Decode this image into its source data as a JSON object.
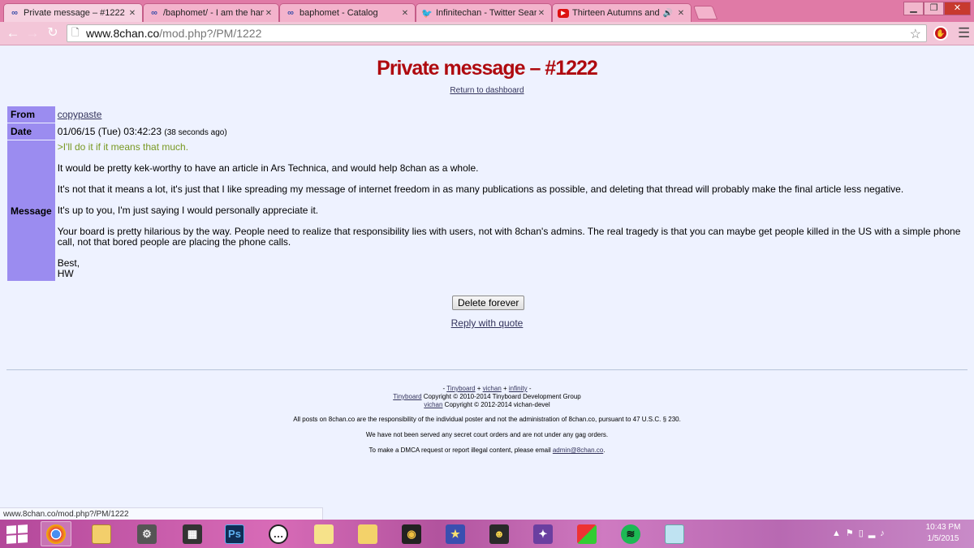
{
  "browser": {
    "tabs": [
      {
        "title": "Private message – #1222",
        "icon": "8chan-icon",
        "active": true
      },
      {
        "title": "/baphomet/ - I am the hammer",
        "icon": "8chan-icon",
        "active": false
      },
      {
        "title": "baphomet - Catalog",
        "icon": "8chan-icon",
        "active": false
      },
      {
        "title": "Infinitechan - Twitter Search",
        "icon": "twitter-icon",
        "active": false
      },
      {
        "title": "Thirteen Autumns and",
        "icon": "youtube-icon",
        "active": false
      }
    ],
    "url_host": "www.8chan.co",
    "url_path": "/mod.php?/PM/1222",
    "status_url": "www.8chan.co/mod.php?/PM/1222"
  },
  "page": {
    "title": "Private message – #1222",
    "return_link": "Return to dashboard",
    "from_label": "From",
    "from_value": "copypaste",
    "date_label": "Date",
    "date_value": "01/06/15 (Tue) 03:42:23",
    "date_ago": "(38 seconds ago)",
    "message_label": "Message",
    "message": {
      "quote": ">I'll do it if it means that much.",
      "p1": "It would be pretty kek-worthy to have an article in Ars Technica, and would help 8chan as a whole.",
      "p2": "It's not that it means a lot, it's just that I like spreading my message of internet freedom in as many publications as possible, and deleting that thread will probably make the final article less negative.",
      "p3": "It's up to you, I'm just saying I would personally appreciate it.",
      "p4": "Your board is pretty hilarious by the way. People need to realize that responsibility lies with users, not with 8chan's admins. The real tragedy is that you can maybe get people killed in the US with a simple phone call, not that bored people are placing the phone calls.",
      "sign1": "Best,",
      "sign2": "HW"
    },
    "delete_button": "Delete forever",
    "reply_link": "Reply with quote"
  },
  "footer": {
    "dash_left": "- ",
    "tinyboard": "Tinyboard",
    "plus1": " + ",
    "vichan": "vichan",
    "plus2": " + ",
    "infinity": "infinity",
    "dash_right": " -",
    "tinyboard_copy": " Copyright © 2010-2014 Tinyboard Development Group",
    "vichan_copy": " Copyright © 2012-2014 vichan-devel",
    "notice1": "All posts on 8chan.co are the responsibility of the individual poster and not the administration of 8chan.co, pursuant to 47 U.S.C. § 230.",
    "notice2": "We have not been served any secret court orders and are not under any gag orders.",
    "notice3_prefix": "To make a DMCA request or report illegal content, please email ",
    "notice3_email": "admin@8chan.co",
    "notice3_suffix": "."
  },
  "taskbar": {
    "time": "10:43 PM",
    "date": "1/5/2015",
    "apps": [
      "chrome-icon",
      "file-explorer-icon",
      "settings-app-icon",
      "media-app-icon",
      "photoshop-icon",
      "chat-app-icon",
      "anime-app-icon-1",
      "anime-app-icon-2",
      "anime-app-icon-3",
      "anime-app-icon-4",
      "anime-app-icon-5",
      "anime-app-icon-6",
      "games-app-icon",
      "spotify-icon",
      "notes-app-icon"
    ],
    "photoshop_label": "Ps"
  },
  "colors": {
    "tabstrip": "#e07aa6",
    "title_red": "#af0a0f",
    "header_cell": "#9b8cf0",
    "quote_green": "#789922",
    "link": "#34345c",
    "page_bg": "#eef2ff"
  }
}
